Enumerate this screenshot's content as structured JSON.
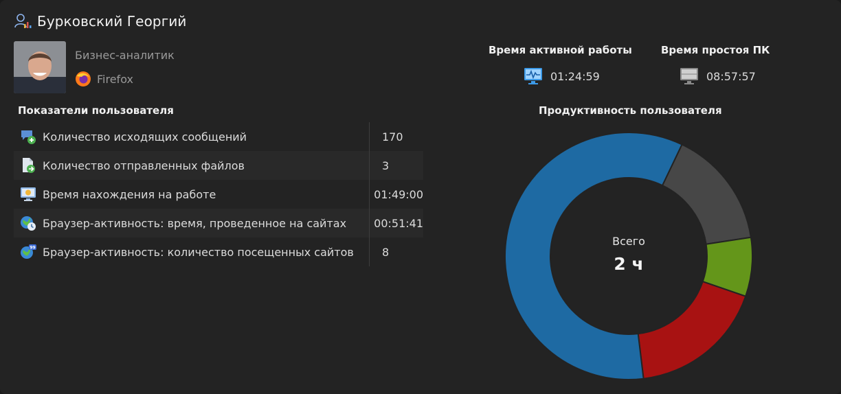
{
  "user": {
    "name": "Бурковский Георгий",
    "role": "Бизнес-аналитик",
    "browser": "Firefox"
  },
  "stats": {
    "active_title": "Время активной работы",
    "active_value": "01:24:59",
    "idle_title": "Время простоя ПК",
    "idle_value": "08:57:57"
  },
  "metrics": {
    "title": "Показатели пользователя",
    "rows": [
      {
        "icon": "outgoing-messages-icon",
        "label": "Количество исходящих сообщений",
        "value": "170"
      },
      {
        "icon": "sent-files-icon",
        "label": "Количество отправленных файлов",
        "value": "3"
      },
      {
        "icon": "work-time-icon",
        "label": "Время нахождения на работе",
        "value": "01:49:00"
      },
      {
        "icon": "browser-time-icon",
        "label": "Браузер-активность: время, проведенное на сайтах",
        "value": "00:51:41"
      },
      {
        "icon": "browser-sites-icon",
        "label": "Браузер-активность: количество посещенных сайтов",
        "value": "8"
      }
    ]
  },
  "chart_data": {
    "type": "pie",
    "title": "Продуктивность пользователя",
    "donut": true,
    "center_label": "Всего",
    "center_value": "2 ч",
    "slices": [
      {
        "value": 15.5,
        "color": "#474747"
      },
      {
        "value": 7.7,
        "color": "#64961a"
      },
      {
        "value": 17.8,
        "color": "#a81212"
      },
      {
        "value": 59.0,
        "color": "#1e6aa3"
      }
    ],
    "start_angle_deg": 25.5
  }
}
